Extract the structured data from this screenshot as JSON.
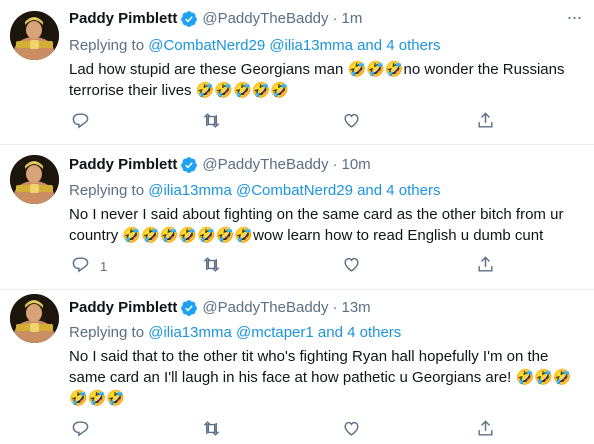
{
  "tweets": [
    {
      "name": "Paddy Pimblett",
      "handle": "@PaddyTheBaddy",
      "dot": "·",
      "time": "1m",
      "replying_prefix": "Replying to ",
      "replying_links": "@CombatNerd29 @ilia13mma and 4 others",
      "text": "Lad how stupid are these Georgians man 🤣🤣🤣no wonder the Russians terrorise their lives 🤣🤣🤣🤣🤣",
      "reply_count": ""
    },
    {
      "name": "Paddy Pimblett",
      "handle": "@PaddyTheBaddy",
      "dot": "·",
      "time": "10m",
      "replying_prefix": "Replying to ",
      "replying_links": "@ilia13mma @CombatNerd29 and 4 others",
      "text": "No I never I said about fighting on the same card as the other bitch from ur country 🤣🤣🤣🤣🤣🤣🤣wow learn how to read English u dumb cunt",
      "reply_count": "1"
    },
    {
      "name": "Paddy Pimblett",
      "handle": "@PaddyTheBaddy",
      "dot": "·",
      "time": "13m",
      "replying_prefix": "Replying to ",
      "replying_links": "@ilia13mma @mctaper1 and 4 others",
      "text": "No I said that to the other tit who's fighting Ryan hall hopefully I'm on the same card an I'll laugh in his face at how pathetic u Georgians are! 🤣🤣🤣🤣🤣🤣",
      "reply_count": ""
    }
  ],
  "icons": {
    "verified": "verified-badge-icon",
    "more": "more-options-icon",
    "reply": "reply-icon",
    "retweet": "retweet-icon",
    "like": "like-icon",
    "share": "share-icon"
  },
  "colors": {
    "accent": "#1b95e0",
    "verified": "#1da1f2",
    "secondary_text": "#5b7083",
    "divider": "#ebeef0"
  }
}
